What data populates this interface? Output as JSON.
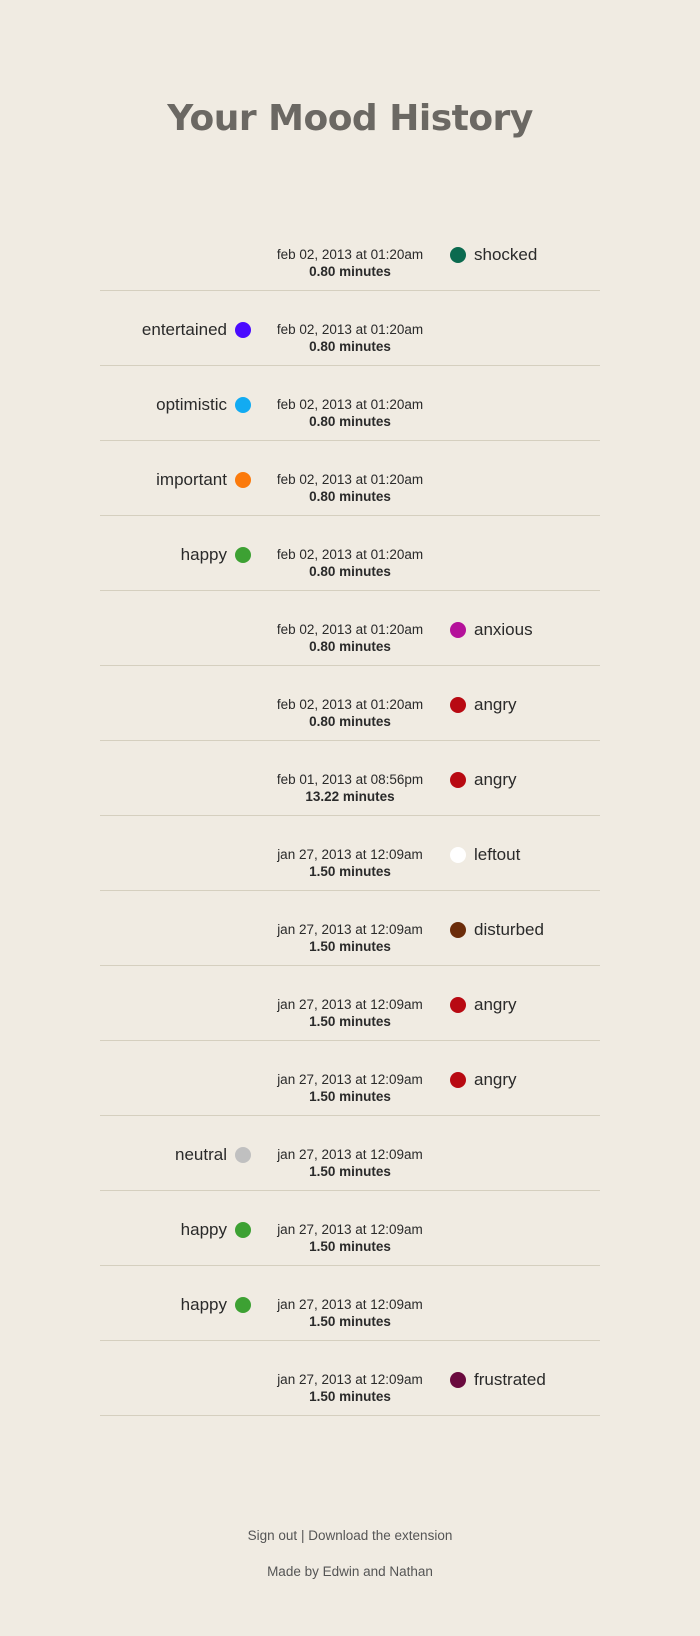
{
  "header": {
    "title": "Your Mood History"
  },
  "entries": [
    {
      "time": "feb 02, 2013 at 01:20am",
      "duration": "0.80 minutes",
      "mood": "shocked",
      "color": "#0b6a4f",
      "side": "right"
    },
    {
      "time": "feb 02, 2013 at 01:20am",
      "duration": "0.80 minutes",
      "mood": "entertained",
      "color": "#4a0bff",
      "side": "left"
    },
    {
      "time": "feb 02, 2013 at 01:20am",
      "duration": "0.80 minutes",
      "mood": "optimistic",
      "color": "#12abf2",
      "side": "left"
    },
    {
      "time": "feb 02, 2013 at 01:20am",
      "duration": "0.80 minutes",
      "mood": "important",
      "color": "#fb7a0c",
      "side": "left"
    },
    {
      "time": "feb 02, 2013 at 01:20am",
      "duration": "0.80 minutes",
      "mood": "happy",
      "color": "#3da133",
      "side": "left"
    },
    {
      "time": "feb 02, 2013 at 01:20am",
      "duration": "0.80 minutes",
      "mood": "anxious",
      "color": "#b4119a",
      "side": "right"
    },
    {
      "time": "feb 02, 2013 at 01:20am",
      "duration": "0.80 minutes",
      "mood": "angry",
      "color": "#b80912",
      "side": "right"
    },
    {
      "time": "feb 01, 2013 at 08:56pm",
      "duration": "13.22 minutes",
      "mood": "angry",
      "color": "#b80912",
      "side": "right"
    },
    {
      "time": "jan 27, 2013 at 12:09am",
      "duration": "1.50 minutes",
      "mood": "leftout",
      "color": "#ffffff",
      "side": "right"
    },
    {
      "time": "jan 27, 2013 at 12:09am",
      "duration": "1.50 minutes",
      "mood": "disturbed",
      "color": "#6b2c0a",
      "side": "right"
    },
    {
      "time": "jan 27, 2013 at 12:09am",
      "duration": "1.50 minutes",
      "mood": "angry",
      "color": "#b80912",
      "side": "right"
    },
    {
      "time": "jan 27, 2013 at 12:09am",
      "duration": "1.50 minutes",
      "mood": "angry",
      "color": "#b80912",
      "side": "right"
    },
    {
      "time": "jan 27, 2013 at 12:09am",
      "duration": "1.50 minutes",
      "mood": "neutral",
      "color": "#c0c0c0",
      "side": "left"
    },
    {
      "time": "jan 27, 2013 at 12:09am",
      "duration": "1.50 minutes",
      "mood": "happy",
      "color": "#3da133",
      "side": "left"
    },
    {
      "time": "jan 27, 2013 at 12:09am",
      "duration": "1.50 minutes",
      "mood": "happy",
      "color": "#3da133",
      "side": "left"
    },
    {
      "time": "jan 27, 2013 at 12:09am",
      "duration": "1.50 minutes",
      "mood": "frustrated",
      "color": "#6a0a3e",
      "side": "right"
    }
  ],
  "footer": {
    "sign_out": "Sign out",
    "separator": "|",
    "download": "Download the extension",
    "credit": "Made by Edwin and Nathan"
  }
}
